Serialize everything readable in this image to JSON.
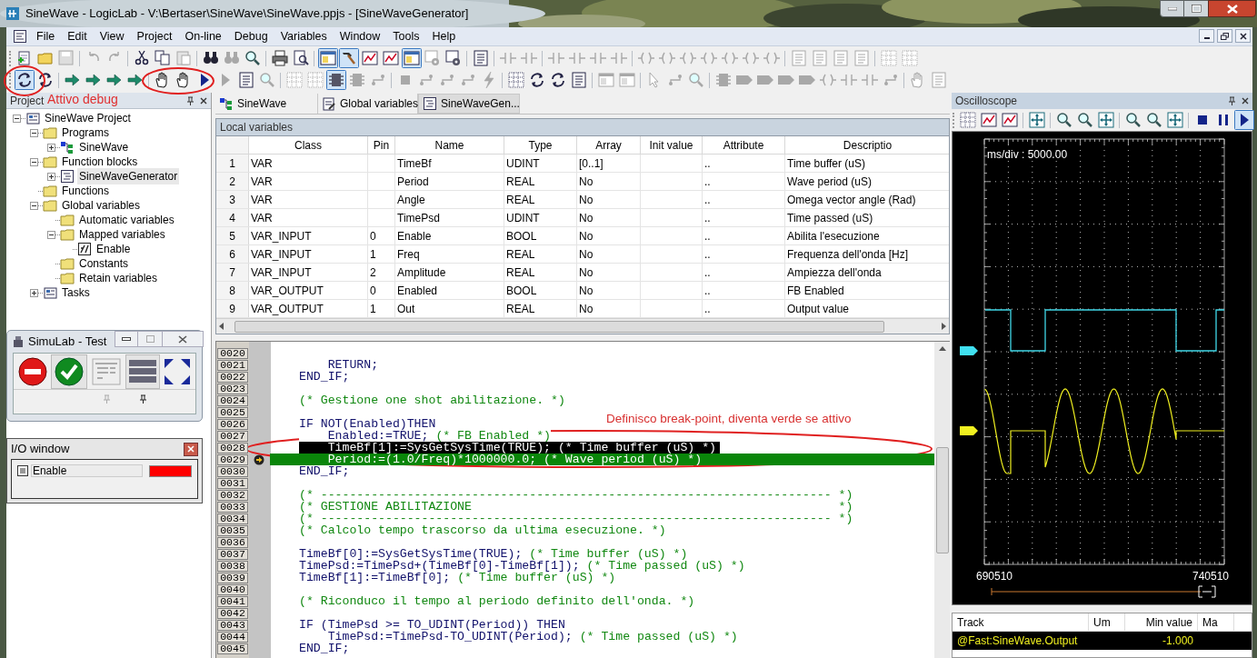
{
  "window": {
    "title": "SineWave - LogicLab - V:\\Bertaser\\SineWave\\SineWave.ppjs - [SineWaveGenerator]"
  },
  "menu": [
    "File",
    "Edit",
    "View",
    "Project",
    "On-line",
    "Debug",
    "Variables",
    "Window",
    "Tools",
    "Help"
  ],
  "annotations": [
    {
      "text": "Attivo debug"
    },
    {
      "text": "Definisco break-point, diventa verde se attivo"
    }
  ],
  "project_panel": {
    "title": "Project",
    "tree": [
      {
        "label": "SineWave Project",
        "kind": "project",
        "expanded": true,
        "selected": false,
        "children": [
          {
            "label": "Programs",
            "kind": "folder",
            "expanded": true,
            "selected": false,
            "children": [
              {
                "label": "SineWave",
                "kind": "program",
                "expanded": false,
                "selected": false
              }
            ]
          },
          {
            "label": "Function blocks",
            "kind": "folder",
            "expanded": true,
            "selected": false,
            "children": [
              {
                "label": "SineWaveGenerator",
                "kind": "block",
                "expanded": false,
                "selected": true
              }
            ]
          },
          {
            "label": "Functions",
            "kind": "folder",
            "selected": false
          },
          {
            "label": "Global variables",
            "kind": "folder",
            "expanded": true,
            "selected": false,
            "children": [
              {
                "label": "Automatic variables",
                "kind": "folder",
                "selected": false
              },
              {
                "label": "Mapped variables",
                "kind": "folder",
                "expanded": true,
                "selected": false,
                "children": [
                  {
                    "label": "Enable",
                    "kind": "variable",
                    "selected": false
                  }
                ]
              },
              {
                "label": "Constants",
                "kind": "folder",
                "selected": false
              },
              {
                "label": "Retain variables",
                "kind": "folder",
                "selected": false
              }
            ]
          },
          {
            "label": "Tasks",
            "kind": "project",
            "expanded": false,
            "selected": false
          }
        ]
      }
    ]
  },
  "simulab": {
    "title": "SimuLab - Test"
  },
  "io_window": {
    "title": "I/O window",
    "items": [
      {
        "label": "Enable",
        "on": true
      }
    ]
  },
  "tabs": [
    {
      "label": "SineWave",
      "kind": "program",
      "selected": false
    },
    {
      "label": "Global variables",
      "kind": "global",
      "selected": false
    },
    {
      "label": "SineWaveGen...",
      "kind": "block",
      "selected": true
    }
  ],
  "local_variables": {
    "title": "Local variables",
    "columns": [
      "Class",
      "Pin",
      "Name",
      "Type",
      "Array",
      "Init value",
      "Attribute",
      "Descriptio"
    ],
    "rows": [
      {
        "index": "1",
        "class": "VAR",
        "name": "TimeBf",
        "type": "UDINT",
        "array": "[0..1]",
        "attribute": "..",
        "description": "Time buffer (uS)"
      },
      {
        "index": "2",
        "class": "VAR",
        "name": "Period",
        "type": "REAL",
        "array": "No",
        "attribute": "..",
        "description": "Wave period (uS)"
      },
      {
        "index": "3",
        "class": "VAR",
        "name": "Angle",
        "type": "REAL",
        "array": "No",
        "attribute": "..",
        "description": "Omega vector angle (Rad)"
      },
      {
        "index": "4",
        "class": "VAR",
        "name": "TimePsd",
        "type": "UDINT",
        "array": "No",
        "attribute": "..",
        "description": "Time passed (uS)"
      },
      {
        "index": "5",
        "class": "VAR_INPUT",
        "pin": "0",
        "name": "Enable",
        "type": "BOOL",
        "array": "No",
        "attribute": "..",
        "description": "Abilita l'esecuzione"
      },
      {
        "index": "6",
        "class": "VAR_INPUT",
        "pin": "1",
        "name": "Freq",
        "type": "REAL",
        "array": "No",
        "attribute": "..",
        "description": "Frequenza dell'onda [Hz]"
      },
      {
        "index": "7",
        "class": "VAR_INPUT",
        "pin": "2",
        "name": "Amplitude",
        "type": "REAL",
        "array": "No",
        "attribute": "..",
        "description": "Ampiezza dell'onda"
      },
      {
        "index": "8",
        "class": "VAR_OUTPUT",
        "pin": "0",
        "name": "Enabled",
        "type": "BOOL",
        "array": "No",
        "attribute": "..",
        "description": "FB Enabled"
      },
      {
        "index": "9",
        "class": "VAR_OUTPUT",
        "pin": "1",
        "name": "Out",
        "type": "REAL",
        "array": "No",
        "attribute": "..",
        "description": "Output value"
      }
    ]
  },
  "code_editor": {
    "lines": [
      {
        "number": "0020",
        "selected": false,
        "breakpoint": false
      },
      {
        "number": "0021",
        "code": "    RETURN;",
        "selected": false,
        "breakpoint": false
      },
      {
        "number": "0022",
        "code": "END_IF;",
        "selected": false,
        "breakpoint": false
      },
      {
        "number": "0023",
        "selected": false,
        "breakpoint": false
      },
      {
        "number": "0024",
        "comment": "(* Gestione one shot abilitazione. *)",
        "selected": false,
        "breakpoint": false
      },
      {
        "number": "0025",
        "selected": false,
        "breakpoint": false
      },
      {
        "number": "0026",
        "code": "IF NOT(Enabled)THEN",
        "selected": false,
        "breakpoint": false
      },
      {
        "number": "0027",
        "code": "    Enabled:=TRUE;",
        "comment": "(* FB Enabled *)",
        "selected": false,
        "breakpoint": false
      },
      {
        "number": "0028",
        "code": "    TimeBf[1]:=SysGetSysTime(TRUE);",
        "comment": "(* Time buffer (uS) *)",
        "selected": true,
        "breakpoint": false
      },
      {
        "number": "0029",
        "code": "    Period:=(1.0/Freq)*1000000.0;",
        "comment": "(* Wave period (uS) *)",
        "selected": false,
        "breakpoint": true
      },
      {
        "number": "0030",
        "code": "END_IF;",
        "selected": false,
        "breakpoint": false
      },
      {
        "number": "0031",
        "selected": false,
        "breakpoint": false
      },
      {
        "number": "0032",
        "comment": "(* ----------------------------------------------------------------------- *)",
        "selected": false,
        "breakpoint": false
      },
      {
        "number": "0033",
        "comment": "(* GESTIONE ABILITAZIONE                                                   *)",
        "selected": false,
        "breakpoint": false
      },
      {
        "number": "0034",
        "comment": "(* ----------------------------------------------------------------------- *)",
        "selected": false,
        "breakpoint": false
      },
      {
        "number": "0035",
        "comment": "(* Calcolo tempo trascorso da ultima esecuzione. *)",
        "selected": false,
        "breakpoint": false
      },
      {
        "number": "0036",
        "selected": false,
        "breakpoint": false
      },
      {
        "number": "0037",
        "code": "TimeBf[0]:=SysGetSysTime(TRUE);",
        "comment": "(* Time buffer (uS) *)",
        "selected": false,
        "breakpoint": false
      },
      {
        "number": "0038",
        "code": "TimePsd:=TimePsd+(TimeBf[0]-TimeBf[1]);",
        "comment": "(* Time passed (uS) *)",
        "selected": false,
        "breakpoint": false
      },
      {
        "number": "0039",
        "code": "TimeBf[1]:=TimeBf[0];",
        "comment": "(* Time buffer (uS) *)",
        "selected": false,
        "breakpoint": false
      },
      {
        "number": "0040",
        "selected": false,
        "breakpoint": false
      },
      {
        "number": "0041",
        "comment": "(* Riconduco il tempo al periodo definito dell'onda. *)",
        "selected": false,
        "breakpoint": false
      },
      {
        "number": "0042",
        "selected": false,
        "breakpoint": false
      },
      {
        "number": "0043",
        "code": "IF (TimePsd >= TO_UDINT(Period)) THEN",
        "selected": false,
        "breakpoint": false
      },
      {
        "number": "0044",
        "code": "    TimePsd:=TimePsd-TO_UDINT(Period);",
        "comment": "(* Time passed (uS) *)",
        "selected": false,
        "breakpoint": false
      },
      {
        "number": "0045",
        "code": "END_IF;",
        "selected": false,
        "breakpoint": false
      }
    ]
  },
  "oscilloscope": {
    "title": "Oscilloscope",
    "scale_label": "ms/div : 5000.00",
    "x_start": "690510",
    "x_end": "740510",
    "track_columns": [
      "Track",
      "Um",
      "Min value",
      "Ma"
    ],
    "tracks": [
      {
        "track": "@Fast:SineWave.Output",
        "min_value": "-1.000"
      }
    ]
  }
}
